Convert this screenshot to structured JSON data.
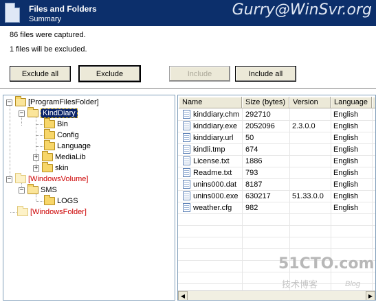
{
  "header": {
    "title": "Files and Folders",
    "subtitle": "Summary",
    "watermark": "Gurry@WinSvr.org",
    "icon": "document-icon"
  },
  "messages": {
    "captured": "86 files were captured.",
    "excluded": "1 files will be excluded."
  },
  "buttons": {
    "exclude_all": "Exclude all",
    "exclude": "Exclude",
    "include": "Include",
    "include_all": "Include all"
  },
  "tree": [
    {
      "label": "[ProgramFilesFolder]",
      "style": "normal",
      "expander": "−"
    },
    {
      "label": "KindDiary",
      "style": "selected",
      "expander": "−"
    },
    {
      "label": "Bin",
      "style": "normal",
      "expander": ""
    },
    {
      "label": "Config",
      "style": "normal",
      "expander": ""
    },
    {
      "label": "Language",
      "style": "normal",
      "expander": ""
    },
    {
      "label": "MediaLib",
      "style": "normal",
      "expander": "+"
    },
    {
      "label": "skin",
      "style": "normal",
      "expander": "+"
    },
    {
      "label": "[WindowsVolume]",
      "style": "red",
      "expander": "−"
    },
    {
      "label": "SMS",
      "style": "normal",
      "expander": "−"
    },
    {
      "label": "LOGS",
      "style": "normal",
      "expander": ""
    },
    {
      "label": "[WindowsFolder]",
      "style": "red",
      "expander": ""
    }
  ],
  "table": {
    "columns": [
      "Name",
      "Size (bytes)",
      "Version",
      "Language",
      "C"
    ],
    "rows": [
      {
        "name": "kinddiary.chm",
        "size": "292710",
        "version": "",
        "language": "English"
      },
      {
        "name": "kinddiary.exe",
        "size": "2052096",
        "version": "2.3.0.0",
        "language": "English"
      },
      {
        "name": "kinddiary.url",
        "size": "50",
        "version": "",
        "language": "English"
      },
      {
        "name": "kindli.tmp",
        "size": "674",
        "version": "",
        "language": "English"
      },
      {
        "name": "License.txt",
        "size": "1886",
        "version": "",
        "language": "English"
      },
      {
        "name": "Readme.txt",
        "size": "793",
        "version": "",
        "language": "English"
      },
      {
        "name": "unins000.dat",
        "size": "8187",
        "version": "",
        "language": "English"
      },
      {
        "name": "unins000.exe",
        "size": "630217",
        "version": "51.33.0.0",
        "language": "English"
      },
      {
        "name": "weather.cfg",
        "size": "982",
        "version": "",
        "language": "English"
      }
    ]
  },
  "watermarks": {
    "brand": "51CTO.com",
    "cn": "技术博客",
    "blog": "Blog"
  },
  "colors": {
    "header_bg": "#0c2f6b",
    "selection": "#0a246a",
    "red_label": "#cc0000"
  }
}
